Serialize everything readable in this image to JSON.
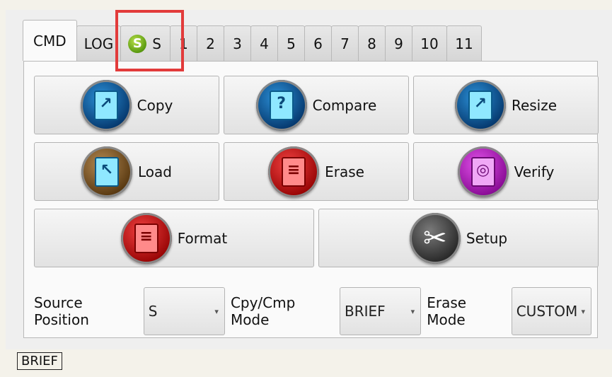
{
  "tabs": [
    "CMD",
    "LOG",
    "S",
    "1",
    "2",
    "3",
    "4",
    "5",
    "6",
    "7",
    "8",
    "9",
    "10",
    "11"
  ],
  "tab_s_icon_letter": "S",
  "buttons": {
    "copy": "Copy",
    "compare": "Compare",
    "resize": "Resize",
    "load": "Load",
    "erase": "Erase",
    "verify": "Verify",
    "format": "Format",
    "setup": "Setup"
  },
  "controls": {
    "source_position_label": "Source Position",
    "source_position_value": "S",
    "cpy_cmp_label": "Cpy/Cmp Mode",
    "cpy_cmp_value": "BRIEF",
    "erase_mode_label": "Erase Mode",
    "erase_mode_value": "CUSTOM"
  },
  "status": "BRIEF",
  "icons": {
    "copy": "copy-icon",
    "compare": "compare-icon",
    "resize": "resize-icon",
    "load": "load-icon",
    "erase": "erase-icon",
    "verify": "verify-icon",
    "format": "format-icon",
    "setup": "wrench-icon"
  }
}
